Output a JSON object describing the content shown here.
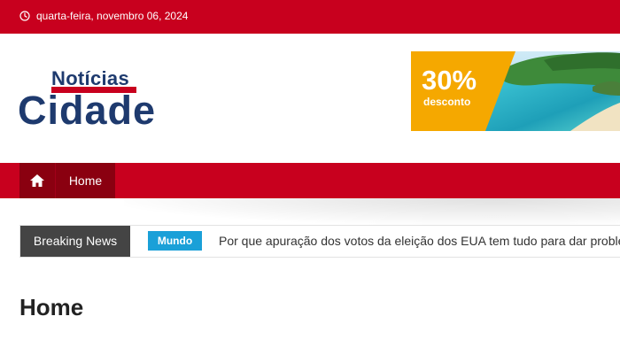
{
  "topbar": {
    "date": "quarta-feira, novembro 06, 2024",
    "icon": "clock-icon"
  },
  "logo": {
    "line1": "Notícias",
    "line2": "Cidade"
  },
  "ad": {
    "percent": "30%",
    "label": "desconto"
  },
  "nav": {
    "home_icon": "home-icon",
    "items": [
      {
        "label": "Home"
      }
    ]
  },
  "ticker": {
    "label": "Breaking News",
    "category": "Mundo",
    "headline": "Por que apuração dos votos da eleição dos EUA tem tudo para dar proble"
  },
  "page": {
    "title": "Home"
  },
  "colors": {
    "brand_red": "#c8001e",
    "dark_red": "#8a0010",
    "navy": "#1e3a6e",
    "ticker_dark": "#444444",
    "tag_blue": "#1aa0d8",
    "ad_orange": "#f5a800"
  }
}
